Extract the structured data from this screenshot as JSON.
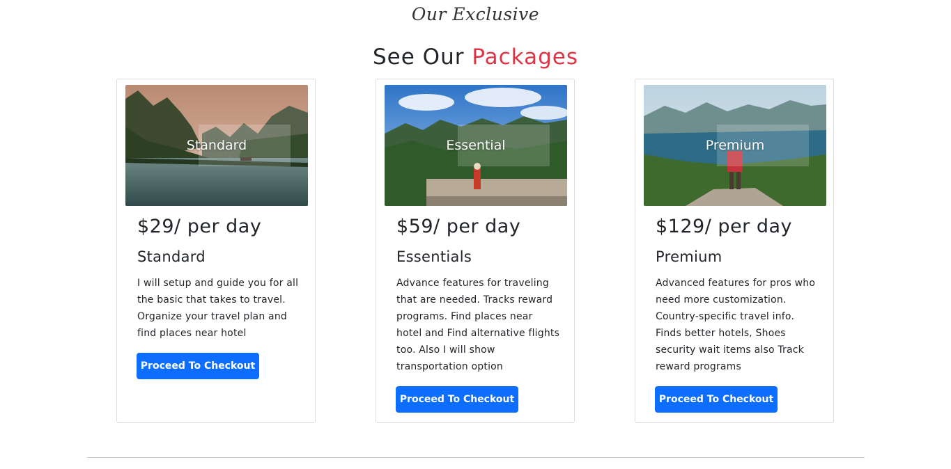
{
  "section": {
    "eyebrow": "Our Exclusive",
    "heading_prefix": "See Our",
    "heading_accent": "Packages"
  },
  "colors": {
    "accent": "#dc3545",
    "button": "#0d6efd",
    "text": "#212529"
  },
  "packages": [
    {
      "image_label": "Standard",
      "price": "$29/ per day",
      "name": "Standard",
      "description": "I will setup and guide you for all the basic that takes to travel. Organize your travel plan and find places near hotel",
      "button_label": "Proceed To Checkout"
    },
    {
      "image_label": "Essential",
      "price": "$59/ per day",
      "name": "Essentials",
      "description": "Advance features for traveling that are needed. Tracks reward programs. Find places near hotel and Find alternative flights too. Also I will show transportation option",
      "button_label": "Proceed To Checkout"
    },
    {
      "image_label": "Premium",
      "price": "$129/ per day",
      "name": "Premium",
      "description": "Advanced features for pros who need more customization. Country-specific travel info. Finds better hotels, Shoes security wait items also Track reward programs",
      "button_label": "Proceed To Checkout"
    }
  ]
}
